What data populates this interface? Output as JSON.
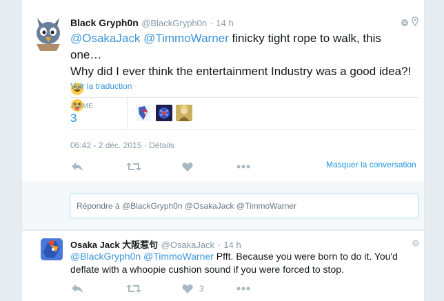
{
  "tweet": {
    "author_name": "Black Gryph0n",
    "author_handle": "@BlackGryph0n",
    "time": "14 h",
    "mention1": "@OsakaJack",
    "mention2": "@TimmoWarner",
    "text_line1": "finicky tight rope to walk, this one…",
    "text_line2": "Why did I ever think the entertainment Industry was a good idea?!",
    "translate_link": "Voir la traduction",
    "likes_label": "J'AIME",
    "likes_count": "3",
    "timestamp": "06:42 - 2 déc. 2015",
    "details_link": "Détails",
    "hide_conversation": "Masquer la conversation"
  },
  "reply_box": {
    "placeholder": "Répondre à @BlackGryph0n @OsakaJack @TimmoWarner"
  },
  "reply_tweet": {
    "author_name": "Osaka Jack 大阪惹句",
    "author_handle": "@OsakaJack",
    "time": "14 h",
    "mention1": "@BlackGryph0n",
    "mention2": "@TimmoWarner",
    "text_line1": "Pfft. Because you were born to do it. You'd",
    "text_line2": "deflate with a whoopie cushion sound if you were forced to stop.",
    "like_count": "3"
  },
  "colors": {
    "link_blue": "#3b94d9",
    "gray_text": "#8899a6",
    "accent_teal": "#1b95e0"
  },
  "icons": [
    "reply-icon",
    "retweet-icon",
    "like-icon",
    "more-icon",
    "globe-icon",
    "location-icon"
  ]
}
